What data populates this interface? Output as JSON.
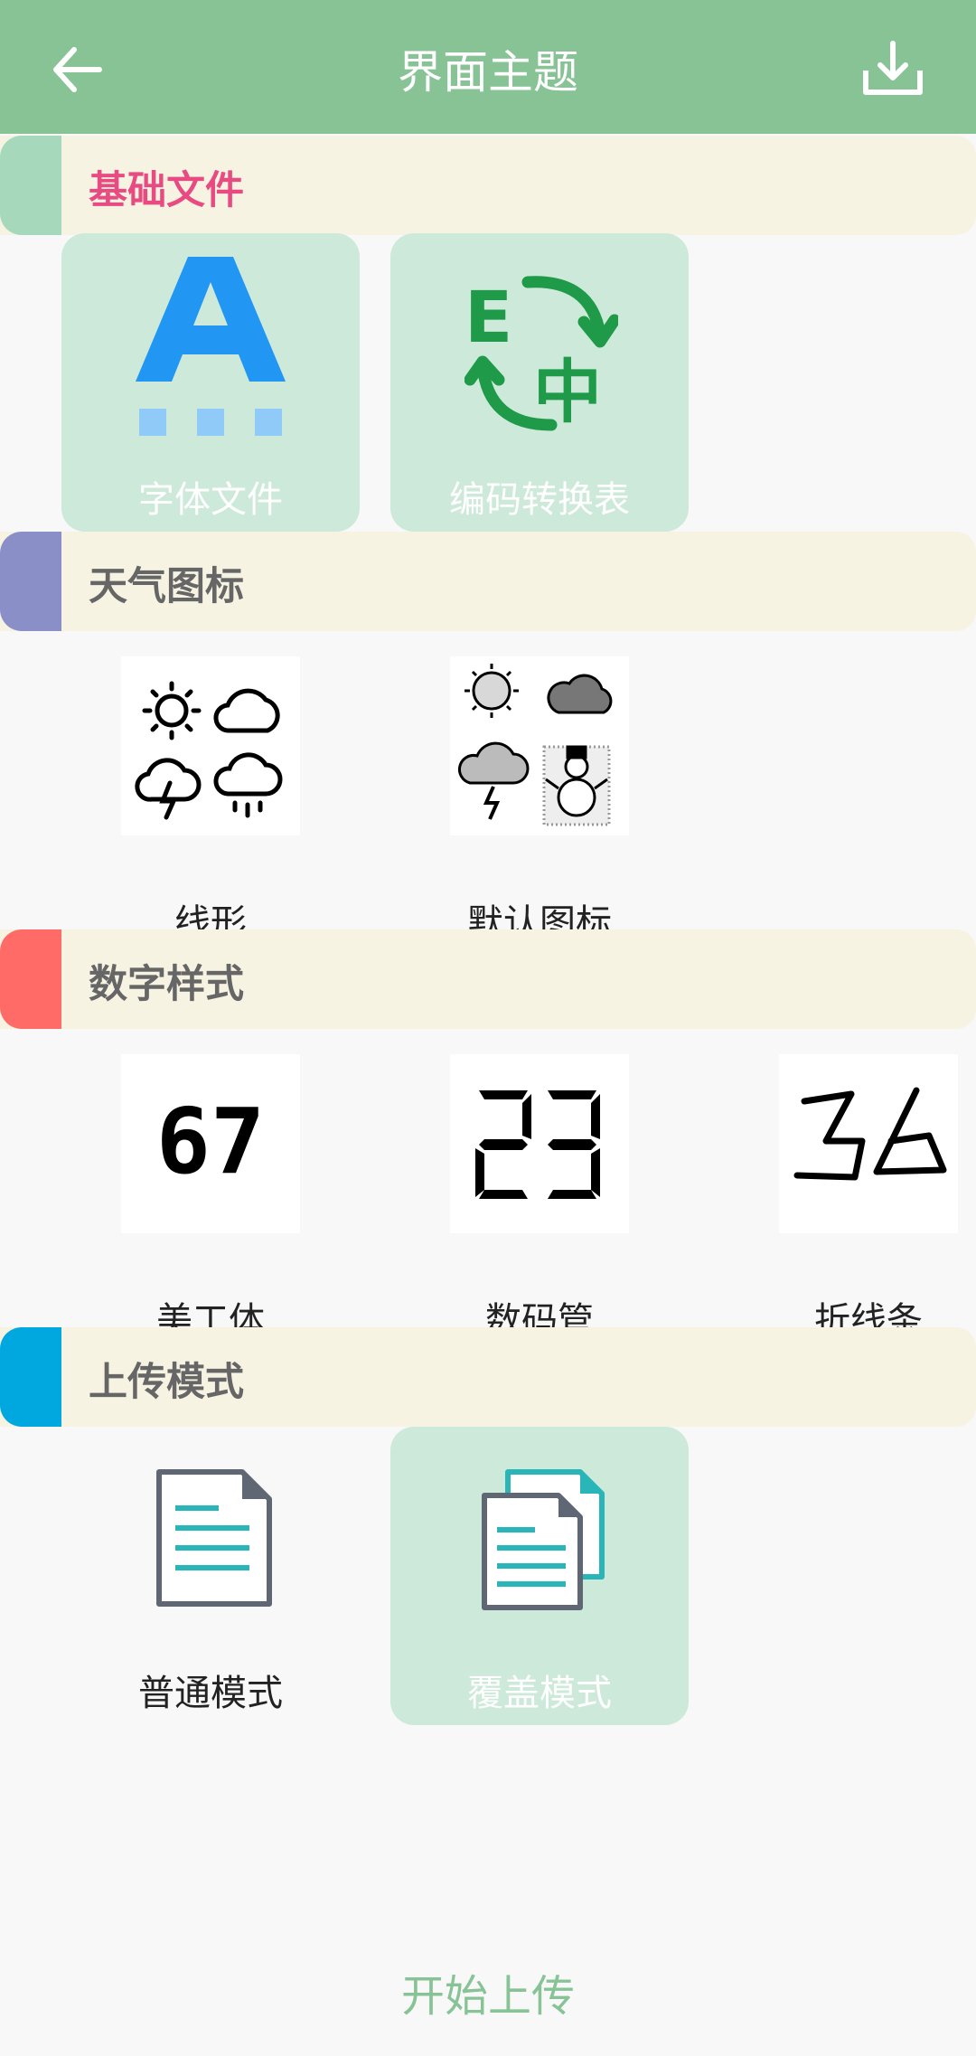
{
  "header": {
    "title": "界面主题",
    "back_icon": "arrow-left-icon",
    "download_icon": "download-icon"
  },
  "sections": [
    {
      "label": "基础文件",
      "stripe_color": "#a6d8bc",
      "label_color": "#e84b82",
      "items": [
        {
          "label": "字体文件",
          "icon": "font-file-icon",
          "selected": true
        },
        {
          "label": "编码转换表",
          "icon": "encoding-table-icon",
          "selected": true
        }
      ]
    },
    {
      "label": "天气图标",
      "stripe_color": "#8b8fc8",
      "label_color": "#666666",
      "items": [
        {
          "label": "线形",
          "icon": "weather-line-icon",
          "selected": false
        },
        {
          "label": "默认图标",
          "icon": "weather-default-icon",
          "selected": false
        }
      ]
    },
    {
      "label": "数字样式",
      "stripe_color": "#ff6b66",
      "label_color": "#666666",
      "items": [
        {
          "label": "美工体",
          "icon": "digits-art-icon",
          "digits": "67",
          "selected": false
        },
        {
          "label": "数码管",
          "icon": "digits-segment-icon",
          "digits": "23",
          "selected": false
        },
        {
          "label": "折线条",
          "icon": "digits-polyline-icon",
          "digits": "36",
          "selected": false
        }
      ]
    },
    {
      "label": "上传模式",
      "stripe_color": "#00a8e0",
      "label_color": "#666666",
      "items": [
        {
          "label": "普通模式",
          "icon": "document-icon",
          "selected": false
        },
        {
          "label": "覆盖模式",
          "icon": "documents-overlay-icon",
          "selected": true
        }
      ]
    }
  ],
  "footer": {
    "start_label": "开始上传"
  },
  "colors": {
    "appbar": "#88c396",
    "selected_tile": "#cde9da",
    "section_bg": "#f6f3e2"
  }
}
